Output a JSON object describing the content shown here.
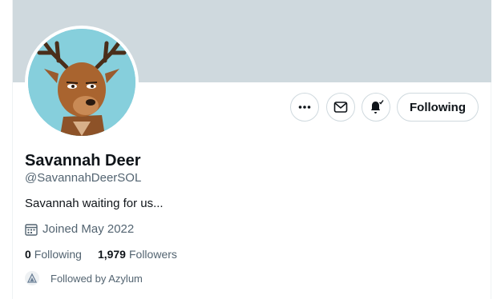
{
  "profile": {
    "display_name": "Savannah Deer",
    "handle": "@SavannahDeerSOL",
    "bio": "Savannah waiting for us...",
    "joined": "Joined May 2022",
    "avatar_icon": "deer-avatar",
    "banner_color": "#cfd9de"
  },
  "actions": {
    "more_icon": "more-icon",
    "message_icon": "mail-icon",
    "notify_icon": "bell-icon",
    "follow_label": "Following"
  },
  "stats": {
    "following_count": "0",
    "following_label": "Following",
    "followers_count": "1,979",
    "followers_label": "Followers"
  },
  "followed_by": {
    "text": "Followed by Azylum",
    "avatar_icon": "azylum-avatar"
  }
}
